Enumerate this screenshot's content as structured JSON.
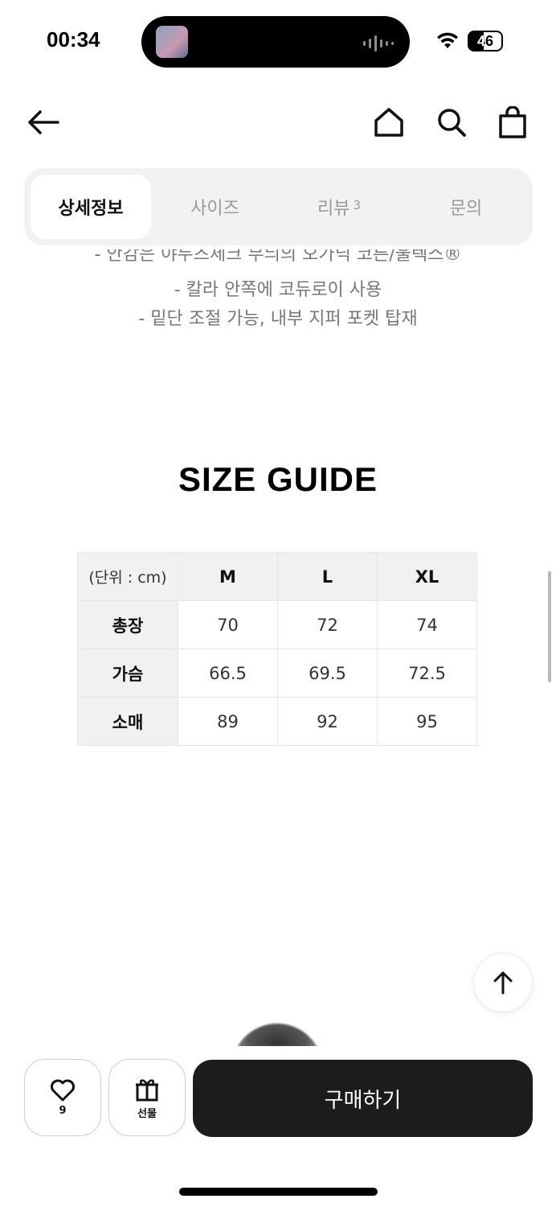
{
  "status_bar": {
    "time": "00:34",
    "battery": "46"
  },
  "tabs": [
    {
      "label": "상세정보",
      "active": true
    },
    {
      "label": "사이즈",
      "active": false
    },
    {
      "label": "리뷰",
      "count": "3",
      "active": false
    },
    {
      "label": "문의",
      "active": false
    }
  ],
  "description_lines": [
    "- 안감은 야두즈체크 무늬의 오가닉 코튼/울텍스®",
    "- 칼라 안쪽에 코듀로이 사용",
    "- 밑단 조절 가능, 내부 지퍼 포켓 탑재"
  ],
  "size_guide": {
    "title": "SIZE GUIDE",
    "unit_label": "(단위 : cm)",
    "sizes": [
      "M",
      "L",
      "XL"
    ],
    "rows": [
      {
        "label": "총장",
        "values": [
          "70",
          "72",
          "74"
        ]
      },
      {
        "label": "가슴",
        "values": [
          "66.5",
          "69.5",
          "72.5"
        ]
      },
      {
        "label": "소매",
        "values": [
          "89",
          "92",
          "95"
        ]
      }
    ]
  },
  "bottom_bar": {
    "like_count": "9",
    "gift_label": "선물",
    "buy_label": "구매하기"
  },
  "icons": {
    "back": "arrow-left-icon",
    "home": "home-icon",
    "search": "search-icon",
    "cart": "shopping-bag-icon",
    "like": "heart-icon",
    "gift": "gift-icon",
    "scroll_top": "arrow-up-icon"
  }
}
